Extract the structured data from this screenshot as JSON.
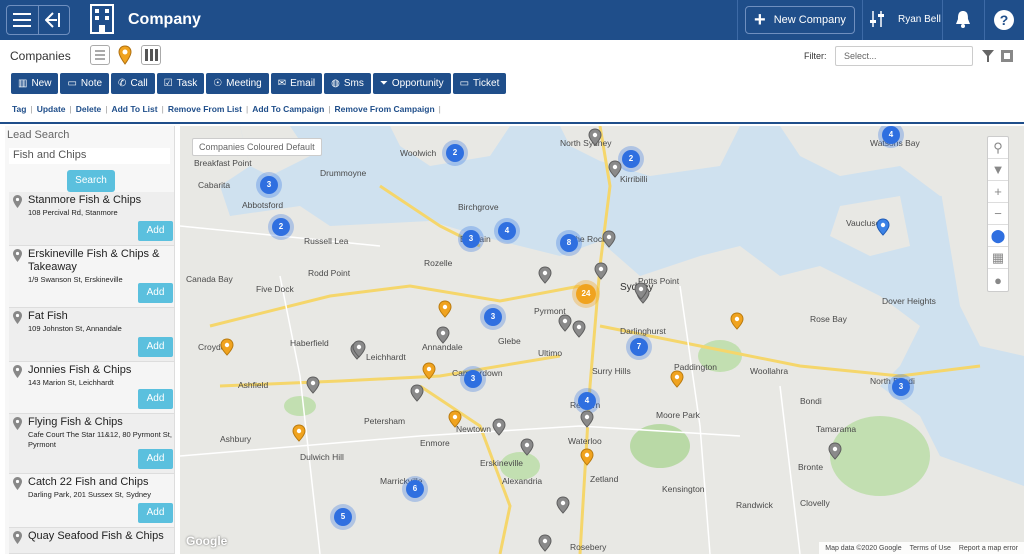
{
  "app": {
    "title": "Company",
    "user": "Ryan Bell",
    "new_company_label": "New Company"
  },
  "page": {
    "title": "Companies",
    "filter_label": "Filter:",
    "filter_placeholder": "Select..."
  },
  "toolbar": [
    {
      "label": "New",
      "icon": "building-icon"
    },
    {
      "label": "Note",
      "icon": "note-icon"
    },
    {
      "label": "Call",
      "icon": "phone-icon"
    },
    {
      "label": "Task",
      "icon": "task-icon"
    },
    {
      "label": "Meeting",
      "icon": "meeting-icon"
    },
    {
      "label": "Email",
      "icon": "email-icon"
    },
    {
      "label": "Sms",
      "icon": "sms-icon"
    },
    {
      "label": "Opportunity",
      "icon": "funnel-icon"
    },
    {
      "label": "Ticket",
      "icon": "ticket-icon"
    }
  ],
  "links": [
    "Tag",
    "Update",
    "Delete",
    "Add To List",
    "Remove From List",
    "Add To Campaign",
    "Remove From Campaign"
  ],
  "lead_search": {
    "title": "Lead Search",
    "query": "Fish and Chips",
    "search_label": "Search",
    "add_label": "Add",
    "results": [
      {
        "name": "Stanmore Fish & Chips",
        "address": "108 Percival Rd, Stanmore"
      },
      {
        "name": "Erskineville Fish & Chips & Takeaway",
        "address": "1/9 Swanson St, Erskineville"
      },
      {
        "name": "Fat Fish",
        "address": "109 Johnston St, Annandale"
      },
      {
        "name": "Jonnies Fish & Chips",
        "address": "143 Marion St, Leichhardt"
      },
      {
        "name": "Flying Fish & Chips",
        "address": "Cafe Court The Star 11&12, 80 Pyrmont St, Pyrmont"
      },
      {
        "name": "Catch 22 Fish and Chips",
        "address": "Darling Park, 201 Sussex St, Sydney"
      },
      {
        "name": "Quay Seafood Fish & Chips",
        "address": ""
      }
    ]
  },
  "map": {
    "chip": "Companies Coloured Default",
    "footer": [
      "Map data ©2020 Google",
      "Terms of Use",
      "Report a map error"
    ],
    "google": "Google",
    "labels": [
      "Woolwich",
      "North Sydney",
      "Kirribilli",
      "Watsons Bay",
      "Breakfast Point",
      "Cabarita",
      "Abbotsford",
      "Drummoyne",
      "Birchgrove",
      "Russell Lea",
      "Balmain",
      "The Rocks",
      "Vaucluse",
      "Canada Bay",
      "Rodd Point",
      "Rozelle",
      "Five Dock",
      "Sydney",
      "Potts Point",
      "Dover Heights",
      "Pyrmont",
      "Darlinghurst",
      "Rose Bay",
      "Haberfield",
      "Annandale",
      "Glebe",
      "Croydon",
      "Leichhardt",
      "Ultimo",
      "Paddington",
      "Woollahra",
      "Ashfield",
      "Camperdown",
      "Surry Hills",
      "North Bondi",
      "Petersham",
      "Redfern",
      "Moore Park",
      "Bondi",
      "Ashbury",
      "Newtown",
      "Waterloo",
      "Dulwich Hill",
      "Enmore",
      "Tamarama",
      "Erskineville",
      "Bronte",
      "Marrickville",
      "Alexandria",
      "Zetland",
      "Kensington",
      "Clovelly",
      "Randwick",
      "Rosebery"
    ],
    "clusters": [
      "2",
      "2",
      "4",
      "3",
      "2",
      "3",
      "4",
      "8",
      "24",
      "3",
      "7",
      "3",
      "4",
      "3",
      "6",
      "5"
    ]
  },
  "colors": {
    "header": "#1f4e8a",
    "accent_button": "#5bc0de",
    "cluster": "#2f6fe0",
    "orange_pin": "#f0a31f",
    "grey_pin": "#8a8a8a"
  }
}
